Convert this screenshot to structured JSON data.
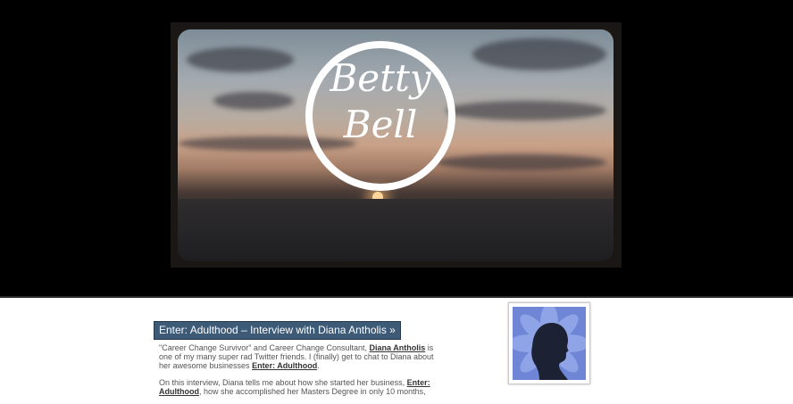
{
  "site": {
    "logo_line1": "Betty",
    "logo_line2": "Bell"
  },
  "post": {
    "title": "Enter: Adulthood – Interview with Diana Antholis »",
    "p1_a": "\"Career Change Survivor\" and Career Change Consultant, ",
    "p1_link1": "Diana Antholis",
    "p1_b": " is one of my many super rad Twitter friends.  I (finally) get to chat to Diana about her awesome businesses ",
    "p1_link2": "Enter: Adulthood",
    "p1_c": ".",
    "p2_a": "On this interview, Diana tells me about how she started her business, ",
    "p2_link": "Enter: Adulthood",
    "p2_b": ", how she accomplished her Masters Degree in only 10 months,"
  },
  "colors": {
    "header_bg": "#000000",
    "title_bg": "#3d5a77",
    "avatar_bg": "#6f86d6"
  }
}
